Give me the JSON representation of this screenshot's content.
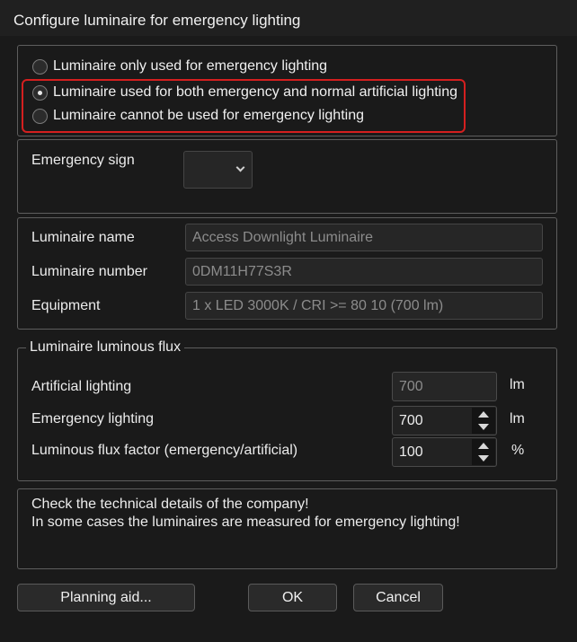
{
  "window": {
    "title": "Configure luminaire for emergency lighting"
  },
  "usage_options": [
    {
      "label": "Luminaire only used for emergency lighting",
      "checked": false
    },
    {
      "label": "Luminaire used for both emergency and normal artificial lighting",
      "checked": true
    },
    {
      "label": "Luminaire cannot be used for emergency lighting",
      "checked": false
    }
  ],
  "emergency_sign": {
    "label": "Emergency sign",
    "selected": ""
  },
  "details": {
    "name_label": "Luminaire name",
    "name_value": "Access Downlight Luminaire",
    "number_label": "Luminaire number",
    "number_value": "0DM11H77S3R",
    "equipment_label": "Equipment",
    "equipment_value": "1 x LED 3000K / CRI >= 80 10 (700 lm)"
  },
  "flux": {
    "group_title": "Luminaire luminous flux",
    "artificial_label": "Artificial lighting",
    "artificial_value": "700",
    "artificial_unit": "lm",
    "emergency_label": "Emergency lighting",
    "emergency_value": "700",
    "emergency_unit": "lm",
    "factor_label": "Luminous flux factor (emergency/artificial)",
    "factor_value": "100",
    "factor_unit": "%"
  },
  "note": {
    "line1": "Check the technical details of the company!",
    "line2": "In some cases the luminaires are measured for emergency lighting!"
  },
  "buttons": {
    "planning_aid": "Planning aid...",
    "ok": "OK",
    "cancel": "Cancel"
  },
  "colors": {
    "highlight": "#d41f1f",
    "background": "#1a1a1a"
  }
}
